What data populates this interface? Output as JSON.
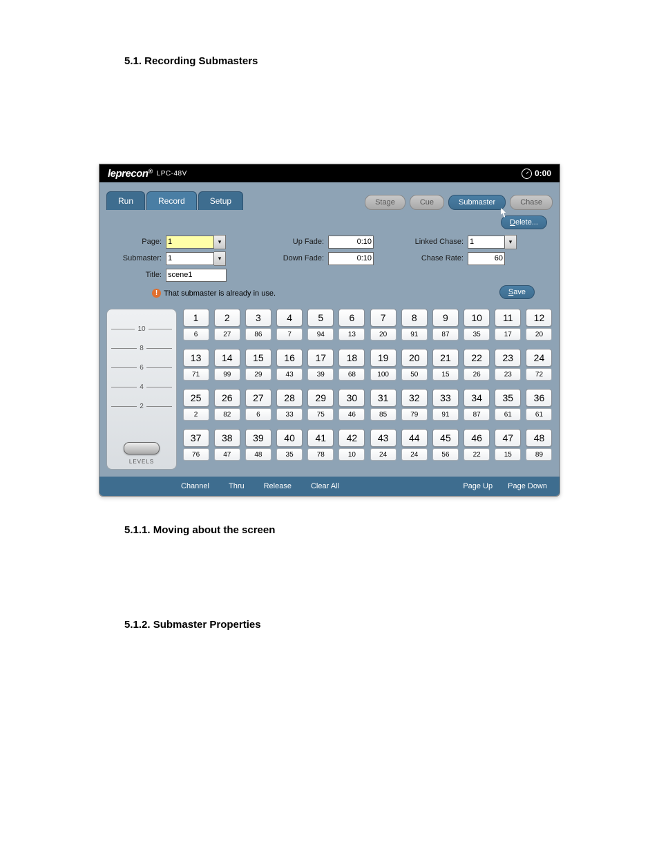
{
  "doc": {
    "h_5_1": "5.1. Recording Submasters",
    "h_5_1_1": "5.1.1. Moving about the screen",
    "h_5_1_2": "5.1.2. Submaster Properties"
  },
  "titlebar": {
    "brand": "leprecon",
    "model": "LPC-48V",
    "clock": "0:00"
  },
  "tabs": {
    "left": [
      "Run",
      "Record",
      "Setup"
    ],
    "right": [
      "Stage",
      "Cue",
      "Submaster",
      "Chase"
    ],
    "right_active": 2
  },
  "buttons": {
    "delete": "Delete...",
    "save": "Save"
  },
  "form": {
    "page_label": "Page:",
    "page_value": "1",
    "submaster_label": "Submaster:",
    "submaster_value": "1",
    "title_label": "Title:",
    "title_value": "scene1",
    "upfade_label": "Up Fade:",
    "upfade_value": "0:10",
    "downfade_label": "Down Fade:",
    "downfade_value": "0:10",
    "linkedchase_label": "Linked Chase:",
    "linkedchase_value": "1",
    "chaserate_label": "Chase Rate:",
    "chaserate_value": "60",
    "warning": "That submaster is already in use."
  },
  "slider": {
    "ticks": [
      "10",
      "8",
      "6",
      "4",
      "2"
    ],
    "label": "LEVELS"
  },
  "channels": [
    [
      {
        "n": "1",
        "v": "6"
      },
      {
        "n": "2",
        "v": "27"
      },
      {
        "n": "3",
        "v": "86"
      },
      {
        "n": "4",
        "v": "7"
      },
      {
        "n": "5",
        "v": "94"
      },
      {
        "n": "6",
        "v": "13"
      },
      {
        "n": "7",
        "v": "20"
      },
      {
        "n": "8",
        "v": "91"
      },
      {
        "n": "9",
        "v": "87"
      },
      {
        "n": "10",
        "v": "35"
      },
      {
        "n": "11",
        "v": "17"
      },
      {
        "n": "12",
        "v": "20"
      }
    ],
    [
      {
        "n": "13",
        "v": "71"
      },
      {
        "n": "14",
        "v": "99"
      },
      {
        "n": "15",
        "v": "29"
      },
      {
        "n": "16",
        "v": "43"
      },
      {
        "n": "17",
        "v": "39"
      },
      {
        "n": "18",
        "v": "68"
      },
      {
        "n": "19",
        "v": "100"
      },
      {
        "n": "20",
        "v": "50"
      },
      {
        "n": "21",
        "v": "15"
      },
      {
        "n": "22",
        "v": "26"
      },
      {
        "n": "23",
        "v": "23"
      },
      {
        "n": "24",
        "v": "72"
      }
    ],
    [
      {
        "n": "25",
        "v": "2"
      },
      {
        "n": "26",
        "v": "82"
      },
      {
        "n": "27",
        "v": "6"
      },
      {
        "n": "28",
        "v": "33"
      },
      {
        "n": "29",
        "v": "75"
      },
      {
        "n": "30",
        "v": "46"
      },
      {
        "n": "31",
        "v": "85"
      },
      {
        "n": "32",
        "v": "79"
      },
      {
        "n": "33",
        "v": "91"
      },
      {
        "n": "34",
        "v": "87"
      },
      {
        "n": "35",
        "v": "61"
      },
      {
        "n": "36",
        "v": "61"
      }
    ],
    [
      {
        "n": "37",
        "v": "76"
      },
      {
        "n": "38",
        "v": "47"
      },
      {
        "n": "39",
        "v": "48"
      },
      {
        "n": "40",
        "v": "35"
      },
      {
        "n": "41",
        "v": "78"
      },
      {
        "n": "42",
        "v": "10"
      },
      {
        "n": "43",
        "v": "24"
      },
      {
        "n": "44",
        "v": "24"
      },
      {
        "n": "45",
        "v": "56"
      },
      {
        "n": "46",
        "v": "22"
      },
      {
        "n": "47",
        "v": "15"
      },
      {
        "n": "48",
        "v": "89"
      }
    ]
  ],
  "bottombar": {
    "left": [
      "Channel",
      "Thru",
      "Release",
      "Clear All"
    ],
    "right": [
      "Page Up",
      "Page Down"
    ]
  }
}
